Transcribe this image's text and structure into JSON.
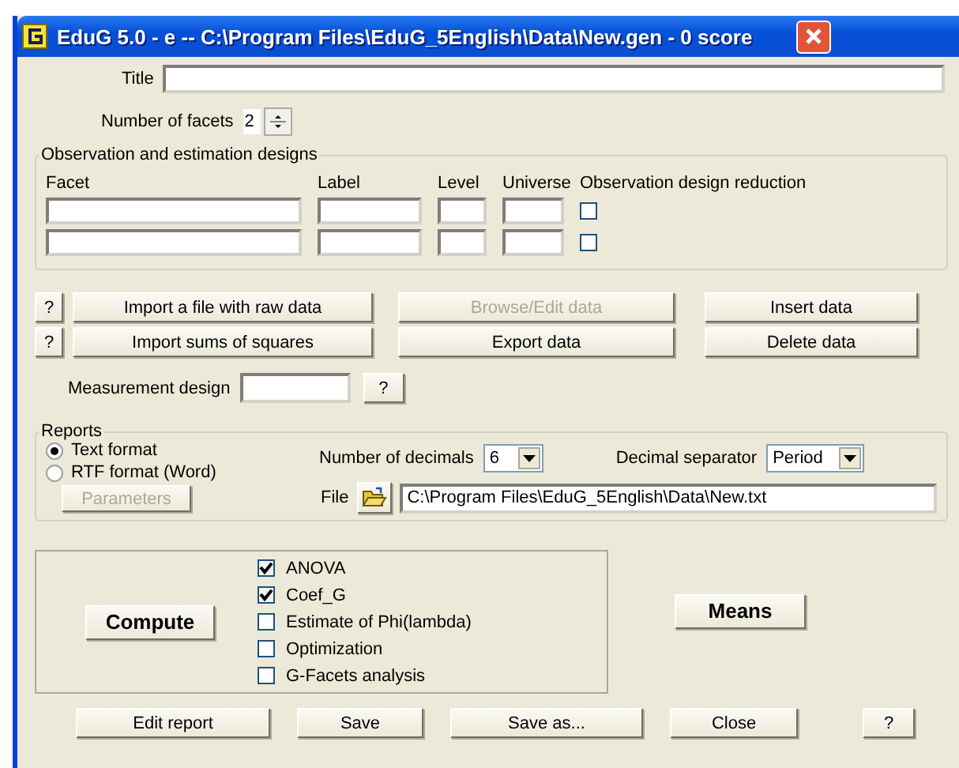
{
  "window": {
    "title": "EduG 5.0 - e -- C:\\Program Files\\EduG_5English\\Data\\New.gen - 0 score"
  },
  "title_field": {
    "label": "Title"
  },
  "facets": {
    "label": "Number of facets",
    "value": "2"
  },
  "designs": {
    "title": "Observation and estimation designs",
    "columns": [
      "Facet",
      "Label",
      "Level",
      "Universe",
      "Observation design reduction"
    ],
    "rows": [
      {
        "checked": false
      },
      {
        "checked": false
      }
    ]
  },
  "data_buttons": [
    {
      "kind": "help",
      "label": "?",
      "disabled": false
    },
    {
      "kind": "button",
      "label": "Import a file with raw data",
      "disabled": false
    },
    {
      "kind": "button",
      "label": "Browse/Edit data",
      "disabled": true
    },
    {
      "kind": "button",
      "label": "Insert data",
      "disabled": false
    },
    {
      "kind": "help",
      "label": "?",
      "disabled": false
    },
    {
      "kind": "button",
      "label": "Import sums of squares",
      "disabled": false
    },
    {
      "kind": "button",
      "label": "Export data",
      "disabled": false
    },
    {
      "kind": "button",
      "label": "Delete data",
      "disabled": false
    }
  ],
  "measurement_design": {
    "label": "Measurement design",
    "help": "?"
  },
  "reports": {
    "title": "Reports",
    "formats": [
      {
        "label": "Text format",
        "selected": true
      },
      {
        "label": "RTF format (Word)",
        "selected": false
      }
    ],
    "parameters": {
      "label": "Parameters",
      "disabled": true
    },
    "decimals": {
      "label": "Number of decimals",
      "value": "6"
    },
    "separator": {
      "label": "Decimal separator",
      "value": "Period"
    },
    "file": {
      "label": "File",
      "value": "C:\\Program Files\\EduG_5English\\Data\\New.txt"
    }
  },
  "compute": {
    "label": "Compute",
    "options": [
      {
        "label": "ANOVA",
        "checked": true
      },
      {
        "label": "Coef_G",
        "checked": true
      },
      {
        "label": "Estimate of Phi(lambda)",
        "checked": false
      },
      {
        "label": "Optimization",
        "checked": false
      },
      {
        "label": "G-Facets analysis",
        "checked": false
      }
    ]
  },
  "means": {
    "label": "Means"
  },
  "footer_buttons": [
    "Edit report",
    "Save",
    "Save as...",
    "Close",
    "?"
  ]
}
